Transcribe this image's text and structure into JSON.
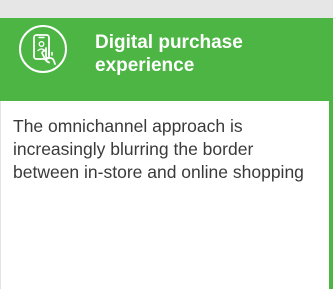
{
  "card": {
    "title": "Digital purchase experience",
    "icon": "mobile-tap-icon",
    "description": "The omnichannel approach is increasingly blurring the border between in-store and online shopping",
    "colors": {
      "header_background": "#4cb543",
      "title_text": "#ffffff",
      "body_text": "#3a3a3a",
      "top_strip": "#e6e6e6"
    }
  }
}
